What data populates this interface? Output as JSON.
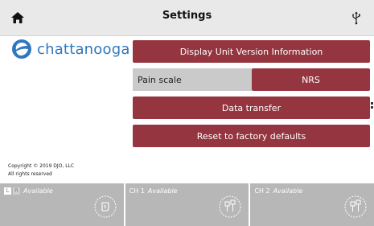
{
  "topbar": {
    "title": "Settings",
    "home_icon": "home-icon",
    "usb_icon": "usb-icon"
  },
  "logo": {
    "text": "chattanooga"
  },
  "buttons": {
    "display_info": "Display Unit Version Information",
    "data_transfer": "Data transfer",
    "reset": "Reset to factory defaults"
  },
  "pain_scale": {
    "label": "Pain scale",
    "value": "NRS"
  },
  "copyright": {
    "line1": "Copyright © 2019 DJO, LLC",
    "line2": "All rights reserved"
  },
  "channels": [
    {
      "id_l": "L",
      "id_r": "R",
      "status": "Available",
      "icon": "electrode-pad-icon"
    },
    {
      "id": "CH 1",
      "status": "Available",
      "icon": "electrodes-icon"
    },
    {
      "id": "CH 2",
      "status": "Available",
      "icon": "electrodes-icon"
    }
  ],
  "colors": {
    "accent": "#94353f",
    "brand_blue": "#2f77c1",
    "channel_bg": "#b7b7b7",
    "topbar_bg": "#e9e9e9"
  }
}
